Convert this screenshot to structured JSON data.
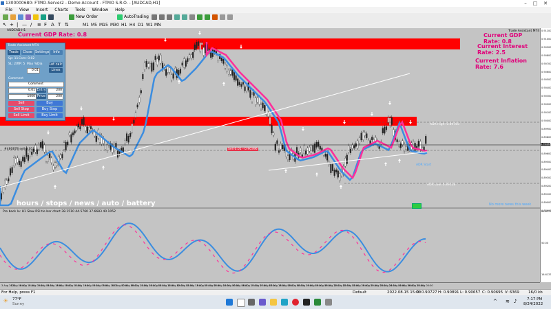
{
  "window": {
    "title": "1300000680: FTMO-Server2 - Demo Account - FTMO S.R.O. - [AUDCAD,H1]"
  },
  "menu": [
    "File",
    "View",
    "Insert",
    "Charts",
    "Tools",
    "Window",
    "Help"
  ],
  "toolbar": {
    "new_order": "New Order",
    "auto_trading": "AutoTrading"
  },
  "chart": {
    "symbol_header": "AUDCAD,H1",
    "gdp_rate_left": "Current GDP Rate: 0.8",
    "gdp_rate_right": "Current GDP Rate: 0.8",
    "interest_rate": "Current Interest Rate: 2.5",
    "inflation_rate": "Current Inflation Rate: 7.6",
    "adr_label": "ADR Hi: 5",
    "trade_assistant": "Trade Assistant MT4",
    "bottom_caption": "hours / stops / news / auto / battery",
    "no_news": "No more news this week",
    "adr_low": "ADR Low: 0.89128",
    "adr_high": "ADR High: 0.89785",
    "adr_start": "ADR Start",
    "sell_line": "Sell 0.01 - 0.90396",
    "line_left": "#460878 sell 0.01",
    "indicator_label": "Pro back lo: H1 Slow RSI tie bar chart 38.1510 44.5760 37.6683 40.1052",
    "price_labels": [
      "0.91100",
      "0.91000",
      "0.90900",
      "0.90800",
      "0.90700",
      "0.90600",
      "0.90500",
      "0.90400",
      "0.90300",
      "0.90200",
      "0.90100",
      "0.90000",
      "0.89900",
      "0.89800",
      "0.89700",
      "0.89600",
      "0.89500",
      "0.89400",
      "0.89300",
      "0.89200",
      "0.89100",
      "0.89000",
      "0.88900"
    ],
    "current_price": "0.90490",
    "indicator_scale": [
      "84.6377",
      "50.00",
      "16.6137"
    ],
    "x_labels": [
      "3 Aug 2022",
      "4 Aug 08:00",
      "4 Aug 16:00",
      "5 Aug 00:00",
      "5 Aug 08:00",
      "5 Aug 16:00",
      "8 Aug 00:00",
      "8 Aug 08:00",
      "8 Aug 16:00",
      "9 Aug 00:00",
      "9 Aug 08:00",
      "9 Aug 16:00",
      "10 Aug 00:00",
      "10 Aug 08:00",
      "10 Aug 16:00",
      "11 Aug 00:00",
      "11 Aug 08:00",
      "11 Aug 16:00",
      "12 Aug 00:00",
      "12 Aug 08:00",
      "12 Aug 16:00",
      "15 Aug 00:00",
      "15 Aug 08:00",
      "15 Aug 16:00",
      "16 Aug 00:00",
      "16 Aug 08:00",
      "16 Aug 16:00",
      "17 Aug 00:00",
      "17 Aug 08:00",
      "17 Aug 16:00",
      "18 Aug 00:00",
      "18 Aug 08:00",
      "18 Aug 16:00",
      "19 Aug 00:00",
      "19 Aug 08:00",
      "19 Aug 16:00",
      "22 Aug 00:00",
      "22 Aug 08:00",
      "22 Aug 16:00",
      "23 Aug 00:00",
      "23 Aug 08:00",
      "23 Aug 16:00",
      "24 Aug 00:00",
      "24 Aug 08:00",
      "24 Aug 16:00",
      "25 Aug 00:00"
    ]
  },
  "panel": {
    "title": "Trade Assistant MT4",
    "tabs": [
      "Trade",
      "Close",
      "Settings",
      "Info"
    ],
    "sp": "Sp: 11",
    "com": "Com: 0.02",
    "lot_calc": "Lot calc",
    "lines": "Lines",
    "sl": "SL: 20",
    "tp": "TP: 5",
    "max_pct": "Max %Dia",
    "val1": "0.01",
    "comment_label": "Comment",
    "comment_value": "Comment",
    "entry_label": "Entry",
    "entry_value": "200",
    "sl_label": "SL",
    "sl_value": "0.01",
    "tp_value": "200",
    "price_label": "Price",
    "price_value": "1000",
    "sell": "Sell",
    "buy": "Buy",
    "sell_stop": "Sell Stop",
    "buy_stop": "Buy Stop",
    "sell_limit": "Sell Limit",
    "buy_limit": "Buy Limit"
  },
  "status": {
    "help": "For Help, press F1",
    "profile": "Default",
    "datetime": "2022.08.15 15:00",
    "open": "O: 0.90727",
    "high": "H: 0.90891",
    "low": "L: 0.90657",
    "close": "C: 0.90695",
    "volume": "V: 6369",
    "traffic": "16/0 kb"
  },
  "taskbar": {
    "temp": "77°F",
    "weather": "Sunny",
    "time": "7:17 PM",
    "date": "8/24/2022"
  },
  "colors": {
    "bull_ma": "#3b8de0",
    "bear_ma": "#ff2f9a",
    "band": "#ff0000",
    "panel": "#6fa0c8",
    "accent": "#e0007a"
  }
}
